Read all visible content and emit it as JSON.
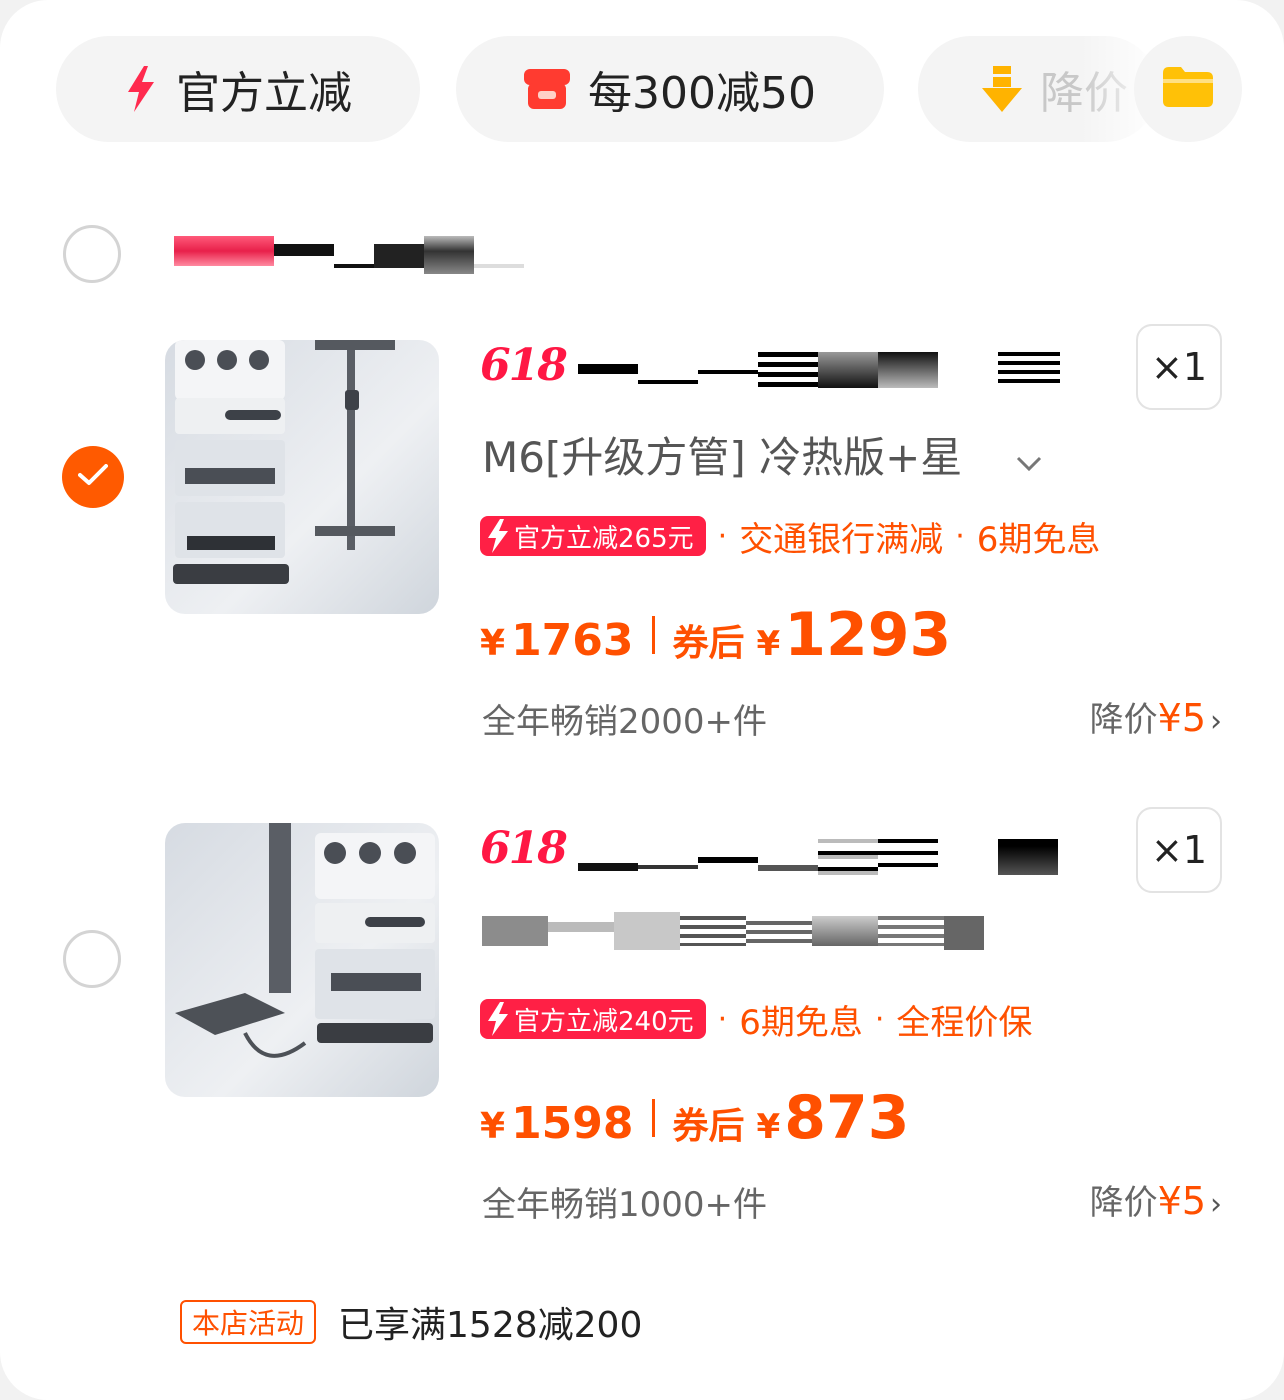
{
  "filters": {
    "chip1": {
      "label": "官方立减",
      "icon": "lightning-icon"
    },
    "chip2": {
      "label": "每300减50",
      "icon": "shop-icon"
    },
    "chip3": {
      "label": "降价",
      "icon": "down-arrow-icon"
    },
    "folder_icon": "folder-icon"
  },
  "items": [
    {
      "brand_badge": "618",
      "qty": "×1",
      "variant": "M6[升级方管] 冷热版+星",
      "promo_tag": "官方立减265元",
      "promo_items": [
        "交通银行满减",
        "6期免息"
      ],
      "price": "1763",
      "after_label": "券后",
      "after_price": "1293",
      "yen": "¥",
      "sales": "全年畅销2000+件",
      "drop_label": "降价",
      "drop_amount": "¥5",
      "checked": true
    },
    {
      "brand_badge": "618",
      "qty": "×1",
      "promo_tag": "官方立减240元",
      "promo_items": [
        "6期免息",
        "全程价保"
      ],
      "price": "1598",
      "after_label": "券后",
      "after_price": "873",
      "yen": "¥",
      "sales": "全年畅销1000+件",
      "drop_label": "降价",
      "drop_amount": "¥5",
      "checked": false
    }
  ],
  "store_activity": {
    "tag": "本店活动",
    "text": "已享满1528减200"
  },
  "colors": {
    "accent": "#ff5000",
    "red": "#ff1744",
    "tag_red": "#ff2045"
  }
}
